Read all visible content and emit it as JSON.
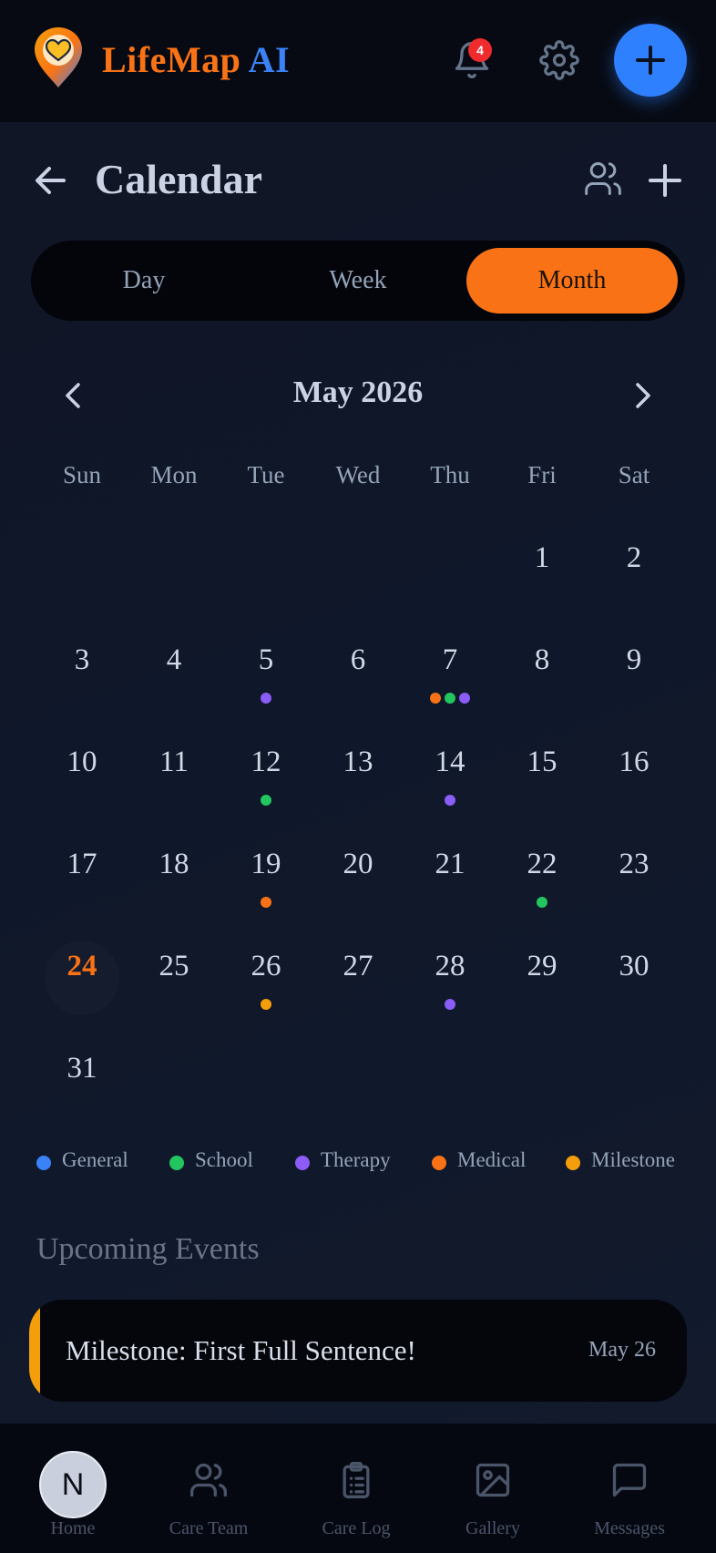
{
  "header": {
    "brand_part1": "LifeMap",
    "brand_part2": "AI",
    "notification_count": "4",
    "icons": [
      "heart-pin-logo-icon",
      "bell-icon",
      "gear-icon",
      "plus-icon"
    ]
  },
  "page": {
    "title": "Calendar",
    "icons": [
      "back-arrow-icon",
      "care-team-icon",
      "add-event-icon"
    ]
  },
  "view_toggle": {
    "options": [
      "Day",
      "Week",
      "Month"
    ],
    "selected": "Month"
  },
  "calendar": {
    "month_label": "May 2026",
    "weekdays": [
      "Sun",
      "Mon",
      "Tue",
      "Wed",
      "Thu",
      "Fri",
      "Sat"
    ],
    "first_weekday_index": 5,
    "days_in_month": 31,
    "today": 24,
    "events": {
      "5": [
        "therapy"
      ],
      "7": [
        "medical",
        "school",
        "therapy"
      ],
      "12": [
        "school"
      ],
      "14": [
        "therapy"
      ],
      "19": [
        "medical"
      ],
      "22": [
        "school"
      ],
      "26": [
        "milestone"
      ],
      "28": [
        "therapy"
      ]
    }
  },
  "legend": [
    {
      "key": "general",
      "label": "General",
      "color": "#3b82f6"
    },
    {
      "key": "school",
      "label": "School",
      "color": "#22c55e"
    },
    {
      "key": "therapy",
      "label": "Therapy",
      "color": "#8b5cf6"
    },
    {
      "key": "medical",
      "label": "Medical",
      "color": "#f97316"
    },
    {
      "key": "milestone",
      "label": "Milestone",
      "color": "#f59e0b"
    }
  ],
  "upcoming": {
    "heading": "Upcoming Events",
    "events": [
      {
        "title": "Milestone: First Full Sentence!",
        "date": "May 26",
        "category": "milestone"
      }
    ]
  },
  "bottom_nav": {
    "avatar_initial": "N",
    "tabs": [
      {
        "label": "Home",
        "icon": "home-icon"
      },
      {
        "label": "Care Team",
        "icon": "care-team-icon"
      },
      {
        "label": "Care Log",
        "icon": "clipboard-icon"
      },
      {
        "label": "Gallery",
        "icon": "image-icon"
      },
      {
        "label": "Messages",
        "icon": "message-icon"
      }
    ]
  },
  "colors": {
    "accent": "#f97316",
    "primary": "#2f80ff",
    "background": "#0f172a"
  }
}
